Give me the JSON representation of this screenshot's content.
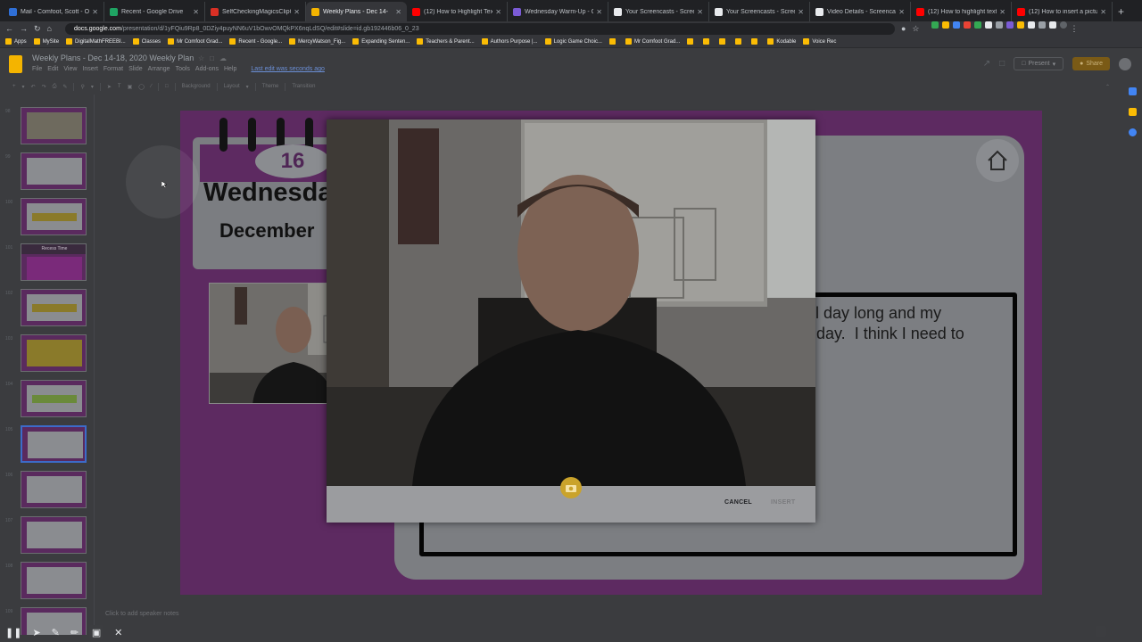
{
  "browser": {
    "tabs": [
      {
        "label": "Mail - Comfoot, Scott - Outl",
        "color": "#2f6fd6"
      },
      {
        "label": "Recent - Google Drive",
        "color": "#1fa463"
      },
      {
        "label": "SelfCheckingMagicsClipCar",
        "color": "#d93025"
      },
      {
        "label": "Weekly Plans - Dec 14-",
        "color": "#f4b400",
        "active": true
      },
      {
        "label": "(12) How to Highlight Text i",
        "color": "#ff0000"
      },
      {
        "label": "Wednesday Warm-Up - Go",
        "color": "#7b5bd6"
      },
      {
        "label": "Your Screencasts - Screenc",
        "color": "#e8eaed"
      },
      {
        "label": "Your Screencasts - Screenc",
        "color": "#e8eaed"
      },
      {
        "label": "Video Details - Screencasti",
        "color": "#e8eaed"
      },
      {
        "label": "(12) How to highlight text in",
        "color": "#ff0000"
      },
      {
        "label": "(12) How to insert a picture",
        "color": "#ff0000"
      }
    ],
    "url_host": "docs.google.com",
    "url_path": "/presentation/d/1yFQiu9Rp8_0DZiy4puyNN6uV1bOwvOMQkPX6nqLdSQ/edit#slide=id.gb192446b06_0_23",
    "bookmarks": [
      "Apps",
      "MySite",
      "DigitalMathFREEBI...",
      "Classes",
      "Mr Comfoot Grad...",
      "Recent - Google...",
      "MercyWatson_Fig...",
      "Expanding Senten...",
      "Teachers & Parent...",
      "Authors Purpose |...",
      "Logic Game Choic...",
      "",
      "Mr Comfoot Grad...",
      "",
      "",
      "",
      "",
      "",
      "Kodable",
      "Voice Rec"
    ]
  },
  "slides": {
    "doc_title": "Weekly Plans - Dec 14-18, 2020 Weekly Plan",
    "menu": [
      "File",
      "Edit",
      "View",
      "Insert",
      "Format",
      "Slide",
      "Arrange",
      "Tools",
      "Add-ons",
      "Help"
    ],
    "last_edit": "Last edit was seconds ago",
    "present_label": "Present",
    "share_label": "Share",
    "toolbar": [
      "Background",
      "Layout",
      "Theme",
      "Transition"
    ],
    "thumbnails": [
      {
        "num": "98",
        "style": "img"
      },
      {
        "num": "99",
        "style": "plain"
      },
      {
        "num": "100",
        "style": "banner",
        "text": "Work on Reading"
      },
      {
        "num": "101",
        "style": "dark",
        "text": "Recess Time"
      },
      {
        "num": "102",
        "style": "banner",
        "text": "Work on Reading"
      },
      {
        "num": "103",
        "style": "yellow"
      },
      {
        "num": "104",
        "style": "green"
      },
      {
        "num": "105",
        "style": "selected"
      },
      {
        "num": "106",
        "style": "plain"
      },
      {
        "num": "107",
        "style": "plain"
      },
      {
        "num": "108",
        "style": "plain"
      },
      {
        "num": "109",
        "style": "plain"
      }
    ],
    "notes_placeholder": "Click to add speaker notes"
  },
  "slide": {
    "calendar_number": "16",
    "calendar_day": "Wednesday",
    "calendar_month": "December",
    "body_text": "ll day long and my\n day.  I think I need to"
  },
  "dialog": {
    "cancel_label": "CANCEL",
    "insert_label": "INSERT"
  },
  "recording": {
    "controls": [
      "pause-icon",
      "cursor-icon",
      "pen-icon",
      "highlighter-icon",
      "camera-icon",
      "close-icon"
    ]
  },
  "colors": {
    "slide_bg": "#5d2a61",
    "capture_button": "#caa32b"
  }
}
